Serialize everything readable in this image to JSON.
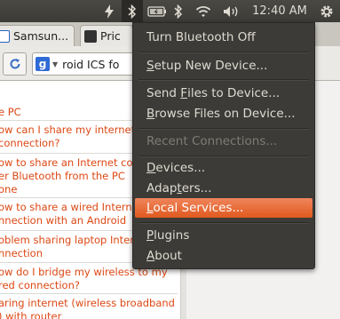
{
  "panel": {
    "clock": "12:40 AM",
    "icons": [
      "bolt-icon",
      "bluetooth-icon",
      "battery-icon",
      "bluetooth-icon",
      "wifi-icon",
      "volume-icon",
      "gear-icon"
    ]
  },
  "browser": {
    "tabs": [
      {
        "label": "Samsun..."
      },
      {
        "label": "Pric"
      }
    ],
    "search_text": "roid ICS fo",
    "links": [
      {
        "lines": [
          "e PC"
        ]
      },
      {
        "lines": [
          "ow can I share my internet",
          "connection?"
        ]
      },
      {
        "lines": [
          "ow to share an Internet co",
          "er Bluetooth from the PC",
          "one"
        ]
      },
      {
        "lines": [
          "ow to share a wired Intern",
          "nnection with an Android"
        ]
      },
      {
        "lines": [
          "oblem sharing laptop Intern",
          "nnection"
        ]
      },
      {
        "lines": [
          "ow do I bridge my wireless to my",
          "red connection?"
        ]
      },
      {
        "lines": [
          "aring internet (wireless broadband",
          ") with router"
        ]
      }
    ],
    "link_color": "#dd4814"
  },
  "bluetooth_menu": {
    "items": [
      {
        "label_pre": "",
        "label_ul": "",
        "label_post": "Turn Bluetooth Off"
      },
      {
        "label_pre": "",
        "label_ul": "S",
        "label_post": "etup New Device..."
      },
      {
        "label_pre": "Send ",
        "label_ul": "F",
        "label_post": "iles to Device..."
      },
      {
        "label_pre": "",
        "label_ul": "B",
        "label_post": "rowse Files on Device..."
      },
      {
        "label_pre": "",
        "label_ul": "",
        "label_post": "Recent Connections..."
      },
      {
        "label_pre": "",
        "label_ul": "D",
        "label_post": "evices..."
      },
      {
        "label_pre": "Adap",
        "label_ul": "t",
        "label_post": "ers..."
      },
      {
        "label_pre": "",
        "label_ul": "L",
        "label_post": "ocal Services..."
      },
      {
        "label_pre": "",
        "label_ul": "P",
        "label_post": "lugins"
      },
      {
        "label_pre": "",
        "label_ul": "A",
        "label_post": "bout"
      }
    ],
    "highlight_color": "#e05a1f"
  }
}
